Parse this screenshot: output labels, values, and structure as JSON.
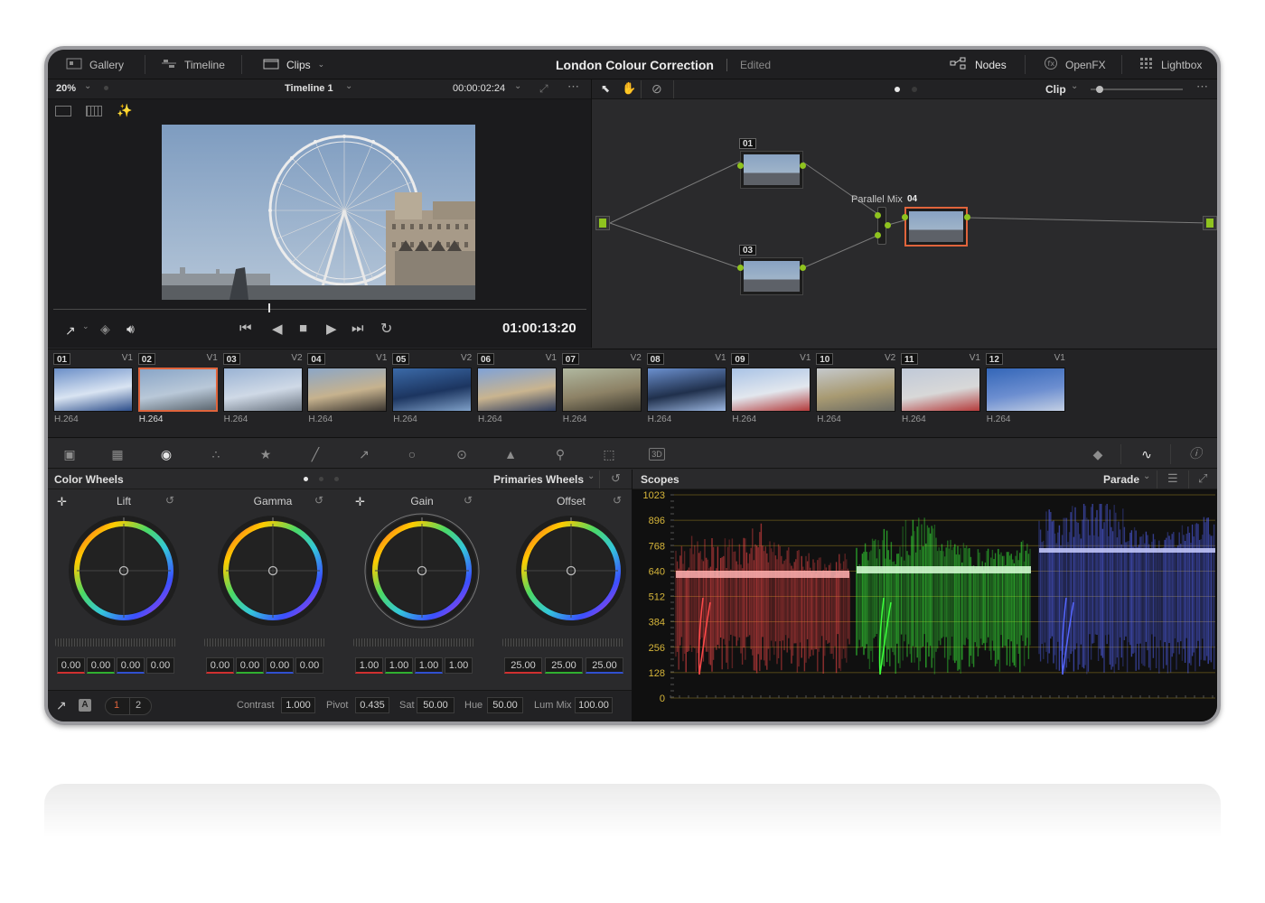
{
  "topbar": {
    "gallery": "Gallery",
    "timeline": "Timeline",
    "clips": "Clips",
    "project_title": "London Colour Correction",
    "status": "Edited",
    "nodes": "Nodes",
    "openfx": "OpenFX",
    "lightbox": "Lightbox"
  },
  "viewer": {
    "zoom": "20%",
    "timeline_name": "Timeline 1",
    "source_timecode": "00:00:02:24",
    "timecode": "01:00:13:20"
  },
  "node_editor": {
    "mode": "Clip",
    "nodes": [
      {
        "id": "01"
      },
      {
        "id": "03"
      },
      {
        "id": "04"
      }
    ],
    "mixer_label": "Parallel Mix"
  },
  "clips": [
    {
      "num": "01",
      "track": "V1",
      "codec": "H.264",
      "selected": false
    },
    {
      "num": "02",
      "track": "V1",
      "codec": "H.264",
      "selected": true
    },
    {
      "num": "03",
      "track": "V2",
      "codec": "H.264",
      "selected": false
    },
    {
      "num": "04",
      "track": "V1",
      "codec": "H.264",
      "selected": false
    },
    {
      "num": "05",
      "track": "V2",
      "codec": "H.264",
      "selected": false
    },
    {
      "num": "06",
      "track": "V1",
      "codec": "H.264",
      "selected": false
    },
    {
      "num": "07",
      "track": "V2",
      "codec": "H.264",
      "selected": false
    },
    {
      "num": "08",
      "track": "V1",
      "codec": "H.264",
      "selected": false
    },
    {
      "num": "09",
      "track": "V1",
      "codec": "H.264",
      "selected": false
    },
    {
      "num": "10",
      "track": "V2",
      "codec": "H.264",
      "selected": false
    },
    {
      "num": "11",
      "track": "V1",
      "codec": "H.264",
      "selected": false
    },
    {
      "num": "12",
      "track": "V1",
      "codec": "H.264",
      "selected": false
    }
  ],
  "color_wheels": {
    "title": "Color Wheels",
    "mode": "Primaries Wheels",
    "wheels": [
      {
        "label": "Lift",
        "values": [
          "0.00",
          "0.00",
          "0.00",
          "0.00"
        ]
      },
      {
        "label": "Gamma",
        "values": [
          "0.00",
          "0.00",
          "0.00",
          "0.00"
        ]
      },
      {
        "label": "Gain",
        "values": [
          "1.00",
          "1.00",
          "1.00",
          "1.00"
        ]
      },
      {
        "label": "Offset",
        "values": [
          "25.00",
          "25.00",
          "25.00"
        ]
      }
    ],
    "pages": [
      "1",
      "2"
    ],
    "contrast_label": "Contrast",
    "contrast": "1.000",
    "pivot_label": "Pivot",
    "pivot": "0.435",
    "sat_label": "Sat",
    "sat": "50.00",
    "hue_label": "Hue",
    "hue": "50.00",
    "lummix_label": "Lum Mix",
    "lummix": "100.00"
  },
  "scopes": {
    "title": "Scopes",
    "mode": "Parade",
    "scale": [
      "1023",
      "896",
      "768",
      "640",
      "512",
      "384",
      "256",
      "128",
      "0"
    ]
  },
  "colors": {
    "accent_orange": "#e0643c",
    "node_green": "#8fc31f"
  }
}
